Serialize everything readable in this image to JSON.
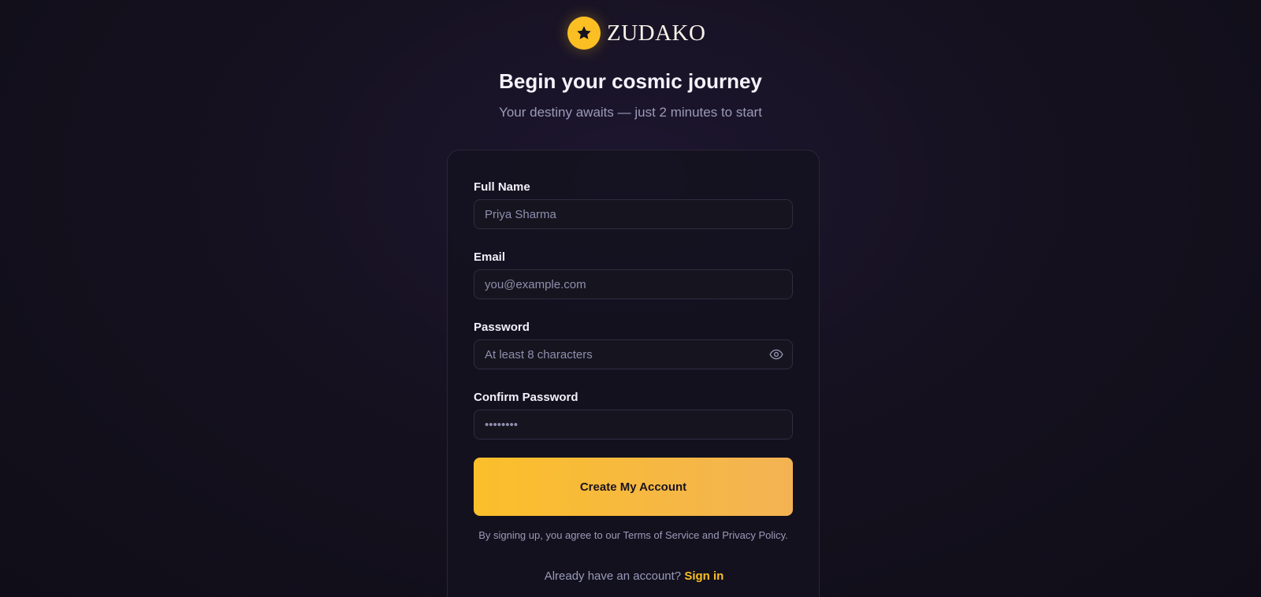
{
  "brand": {
    "name": "ZUDAKO",
    "logo_icon": "star-icon",
    "accent_color": "#fbbf24"
  },
  "header": {
    "title": "Begin your cosmic journey",
    "subtitle": "Your destiny awaits — just 2 minutes to start"
  },
  "form": {
    "full_name": {
      "label": "Full Name",
      "placeholder": "Priya Sharma",
      "value": ""
    },
    "email": {
      "label": "Email",
      "placeholder": "you@example.com",
      "value": ""
    },
    "password": {
      "label": "Password",
      "placeholder": "At least 8 characters",
      "value": "",
      "toggle_icon": "eye-icon"
    },
    "confirm_password": {
      "label": "Confirm Password",
      "placeholder": "••••••••",
      "value": ""
    },
    "submit_label": "Create My Account",
    "terms_text": "By signing up, you agree to our Terms of Service and Privacy Policy.",
    "signin_prompt": "Already have an account?",
    "signin_link": "Sign in"
  }
}
